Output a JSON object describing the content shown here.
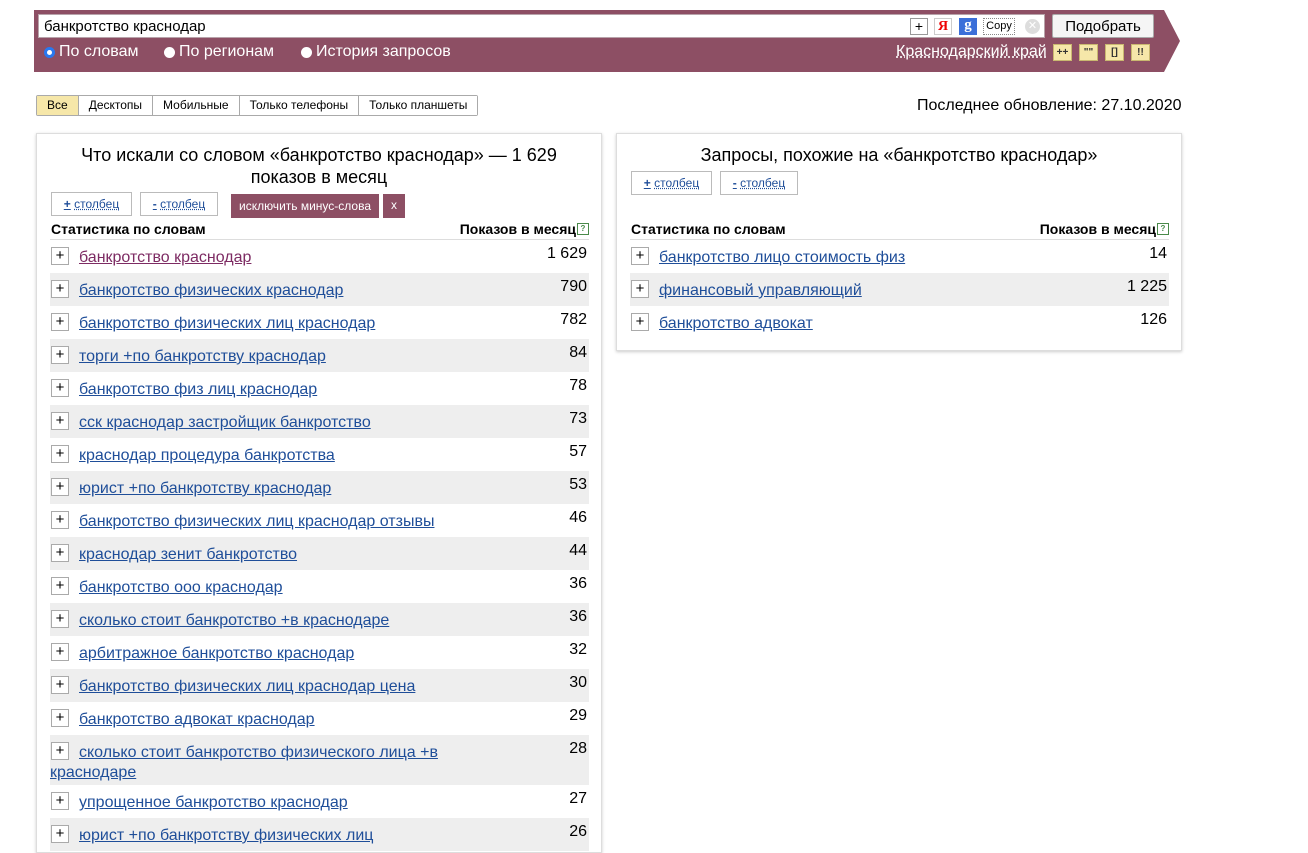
{
  "search": {
    "query": "банкротство краснодар",
    "copy_label": "Copy",
    "ya_label": "Я",
    "g_label": "g",
    "plus_label": "+",
    "clear_label": "✕",
    "pick_label": "Подобрать"
  },
  "modes": [
    {
      "label": "По словам",
      "checked": true
    },
    {
      "label": "По регионам",
      "checked": false
    },
    {
      "label": "История запросов",
      "checked": false
    }
  ],
  "region": "Краснодарский край",
  "operators": [
    "++",
    "\"\"",
    "[]",
    "!!"
  ],
  "device_tabs": [
    "Все",
    "Десктопы",
    "Мобильные",
    "Только телефоны",
    "Только планшеты"
  ],
  "last_update": "Последнее обновление: 27.10.2020",
  "left_panel": {
    "title": "Что искали со словом «банкротство краснодар» — 1 629 показов в месяц",
    "add_column": "столбец",
    "remove_column": "столбец",
    "exclude_minus": "исключить минус-слова",
    "exclude_x": "x",
    "stat_header": "Статистика по словам",
    "shows_header": "Показов в месяц",
    "rows": [
      {
        "phrase": "банкротство краснодар",
        "count": "1 629"
      },
      {
        "phrase": "банкротство физических краснодар",
        "count": "790"
      },
      {
        "phrase": "банкротство физических лиц краснодар",
        "count": "782"
      },
      {
        "phrase": "торги +по банкротству краснодар",
        "count": "84"
      },
      {
        "phrase": "банкротство физ лиц краснодар",
        "count": "78"
      },
      {
        "phrase": "сск краснодар застройщик банкротство",
        "count": "73"
      },
      {
        "phrase": "краснодар процедура банкротства",
        "count": "57"
      },
      {
        "phrase": "юрист +по банкротству краснодар",
        "count": "53"
      },
      {
        "phrase": "банкротство физических лиц краснодар отзывы",
        "count": "46"
      },
      {
        "phrase": "краснодар зенит банкротство",
        "count": "44"
      },
      {
        "phrase": "банкротство ооо краснодар",
        "count": "36"
      },
      {
        "phrase": "сколько стоит банкротство +в краснодаре",
        "count": "36"
      },
      {
        "phrase": "арбитражное банкротство краснодар",
        "count": "32"
      },
      {
        "phrase": "банкротство физических лиц краснодар цена",
        "count": "30"
      },
      {
        "phrase": "банкротство адвокат краснодар",
        "count": "29"
      },
      {
        "phrase": "сколько стоит банкротство физического лица +в краснодаре",
        "count": "28"
      },
      {
        "phrase": "упрощенное банкротство краснодар",
        "count": "27"
      },
      {
        "phrase": "юрист +по банкротству физических лиц",
        "count": "26"
      }
    ]
  },
  "right_panel": {
    "title": "Запросы, похожие на «банкротство краснодар»",
    "add_column": "столбец",
    "remove_column": "столбец",
    "stat_header": "Статистика по словам",
    "shows_header": "Показов в месяц",
    "rows": [
      {
        "phrase": "банкротство лицо стоимость физ",
        "count": "14"
      },
      {
        "phrase": "финансовый управляющий",
        "count": "1 225"
      },
      {
        "phrase": "банкротство адвокат",
        "count": "126"
      }
    ]
  },
  "colors": {
    "accent": "#8d4f64",
    "link": "#1f4e99",
    "operator_bg": "#f6e7a9"
  }
}
